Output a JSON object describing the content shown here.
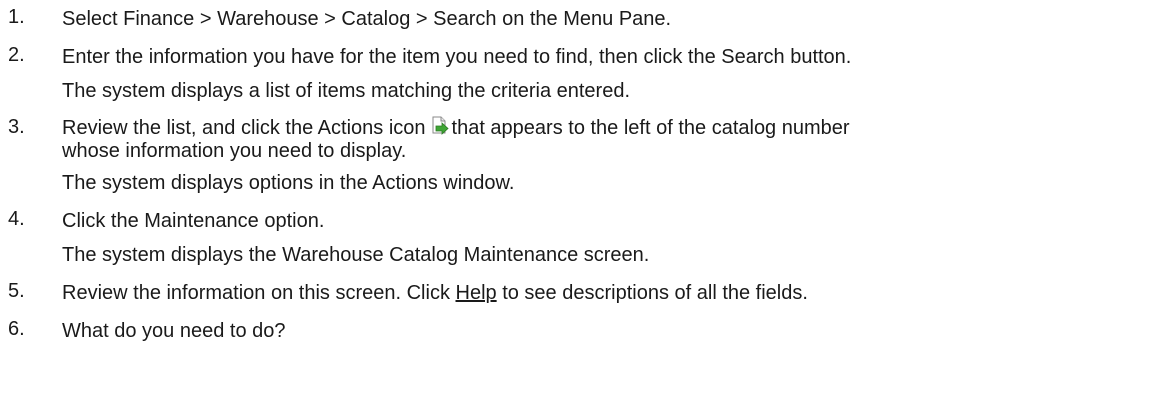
{
  "steps": [
    {
      "number": "1.",
      "text": "Select Finance > Warehouse > Catalog > Search on the Menu Pane."
    },
    {
      "number": "2.",
      "text": "Enter the information you have for the item you need to find, then click the Search button.",
      "result": "The system displays a list of items matching the criteria entered."
    },
    {
      "number": "3.",
      "text_before_icon": "Review the list, and click the Actions icon",
      "icon": "actions-icon",
      "text_after_icon": "that appears to the left of the catalog number",
      "text_line2": "whose information you need to display.",
      "result": "The system displays options in the Actions window."
    },
    {
      "number": "4.",
      "text": "Click the Maintenance option.",
      "result": "The system displays the Warehouse Catalog Maintenance screen."
    },
    {
      "number": "5.",
      "text_before_link": "Review the information on this screen. Click ",
      "link": "Help",
      "text_after_link": " to see descriptions of all the fields."
    },
    {
      "number": "6.",
      "text": "What do you need to do?"
    }
  ],
  "colors": {
    "text": "#1a1a1a",
    "icon_arrow": "#3fa535",
    "icon_page": "#ffffff"
  }
}
